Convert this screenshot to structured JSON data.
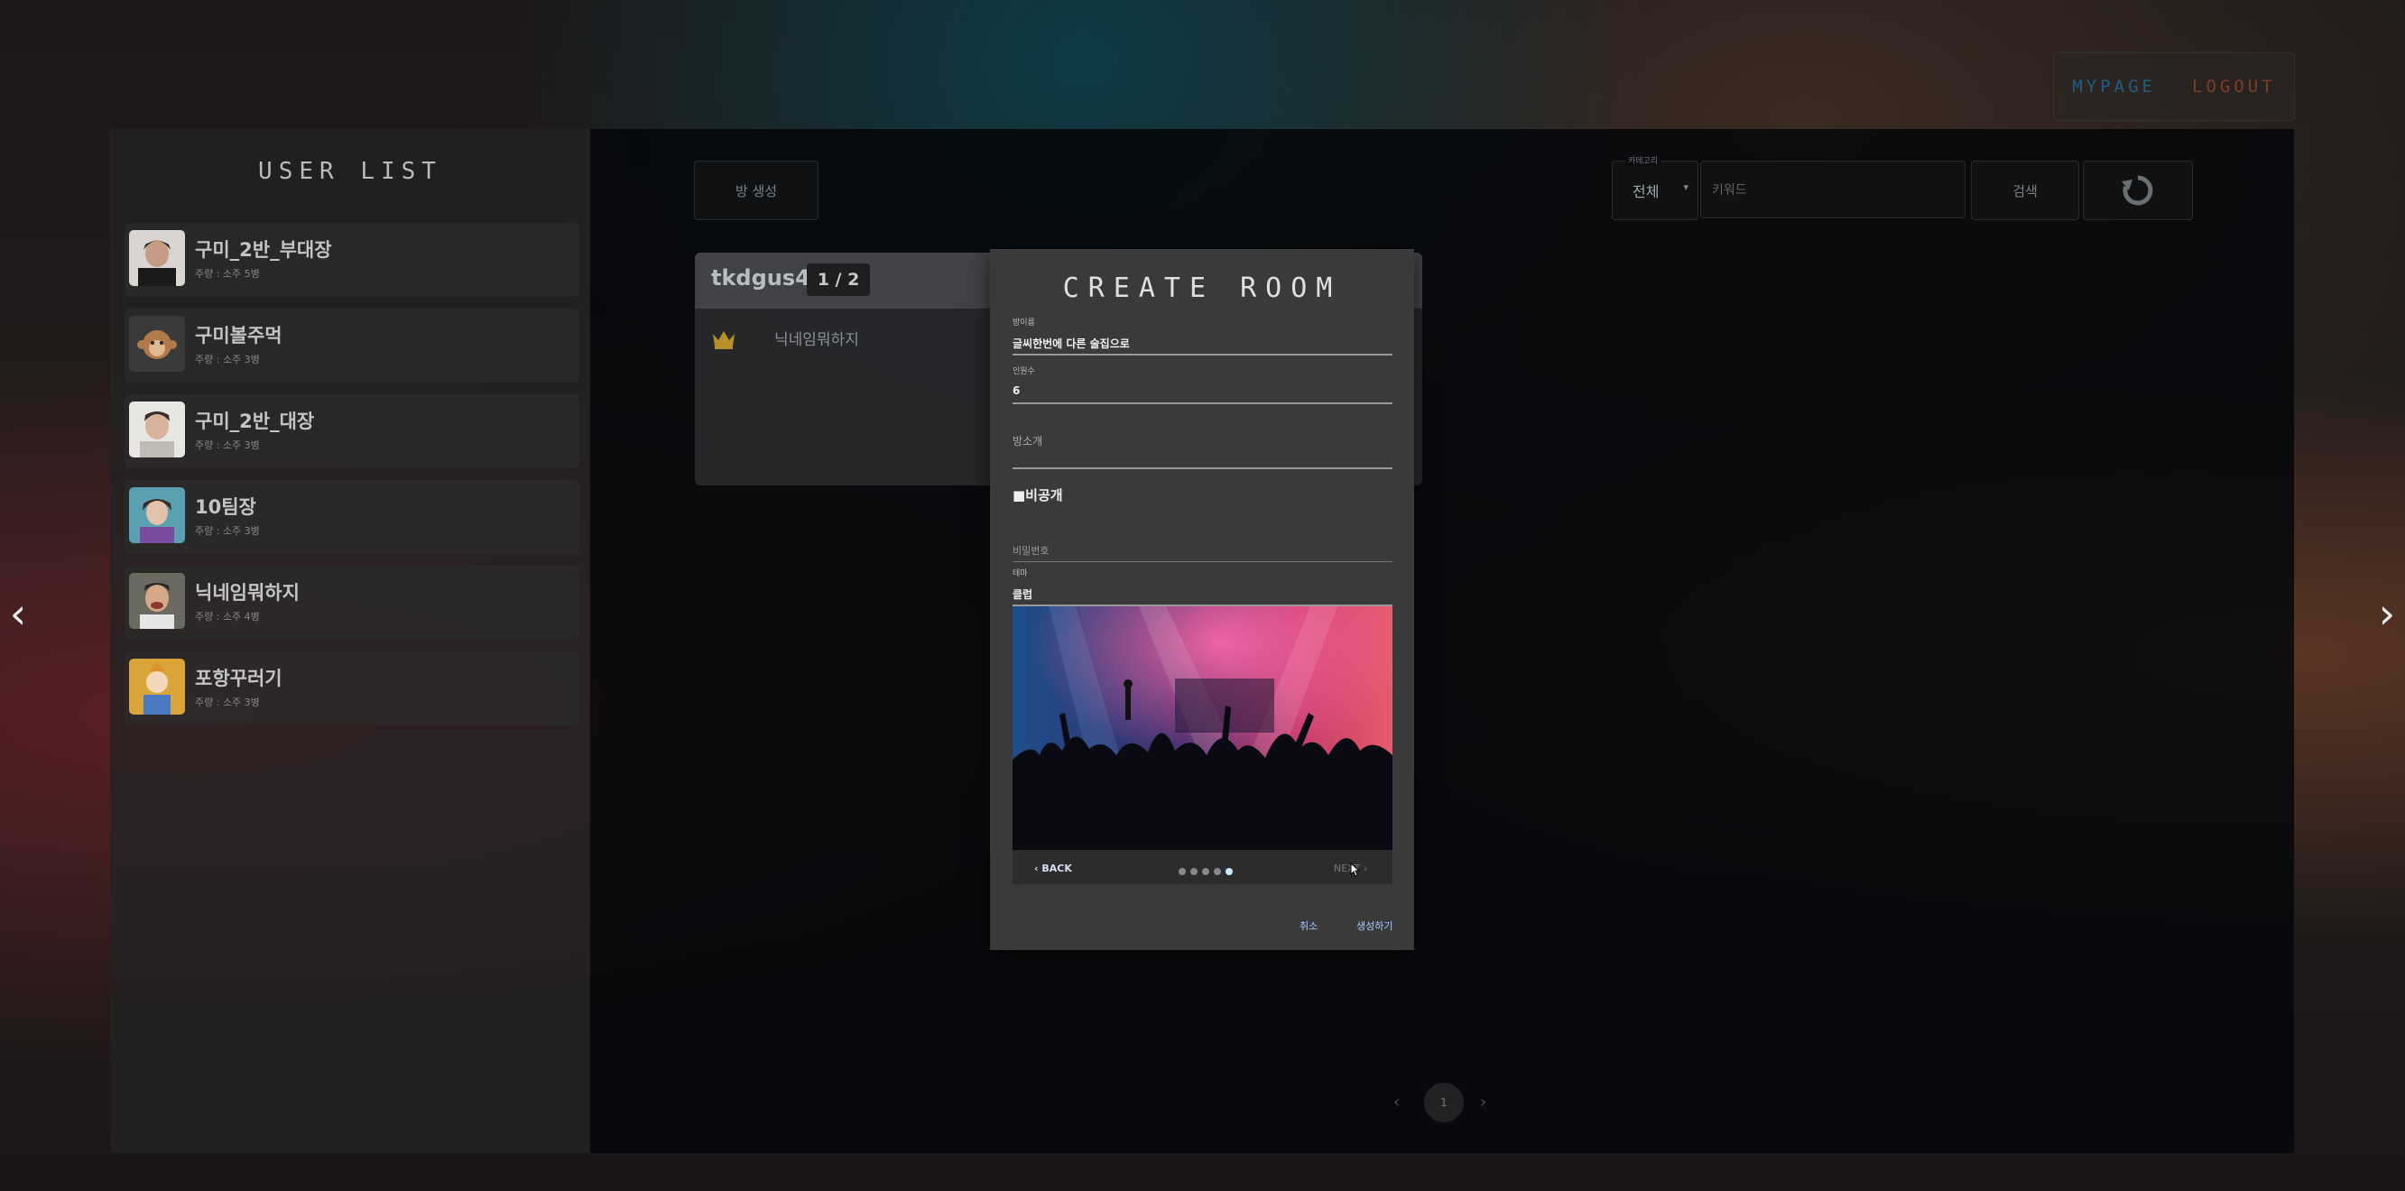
{
  "topnav": {
    "mypage": "MYPAGE",
    "logout": "LOGOUT"
  },
  "user_list": {
    "title": "USER LIST",
    "users": [
      {
        "name": "구미_2반_부대장",
        "sub": "주량 : 소주 5병"
      },
      {
        "name": "구미볼주먹",
        "sub": "주량 : 소주 3병"
      },
      {
        "name": "구미_2반_대장",
        "sub": "주량 : 소주 3병"
      },
      {
        "name": "10팀장",
        "sub": "주량 : 소주 3병"
      },
      {
        "name": "닉네임뭐하지",
        "sub": "주량 : 소주 4병"
      },
      {
        "name": "포항꾸러기",
        "sub": "주량 : 소주 3병"
      }
    ]
  },
  "toolbar": {
    "create_label": "방 생성",
    "category_label": "카테고리",
    "category_value": "전체",
    "keyword_placeholder": "키워드",
    "search_label": "검색"
  },
  "room": {
    "owner": "tkdgus4",
    "count": "1 / 2",
    "member": "닉네임뭐하지"
  },
  "pagination": {
    "current": "1",
    "prev": "‹",
    "next": "›"
  },
  "modal": {
    "title": "CREATE ROOM",
    "room_name_label": "방이름",
    "room_name_value": "글씨한번에 다른 술집으로",
    "capacity_label": "인원수",
    "capacity_value": "6",
    "intro_placeholder": "방소개",
    "private_label": "■비공개",
    "password_placeholder": "비밀번호",
    "theme_label": "테마",
    "theme_value": "클럽",
    "back_label": "BACK",
    "next_label": "NEXT",
    "dots_total": 5,
    "dots_active": 5,
    "cancel_label": "취소",
    "create_label": "생성하기"
  },
  "colors": {
    "mypage": "#1d5f83",
    "logout": "#7a3e2a",
    "modal_bg": "#3a3a3a",
    "action_link": "#a8c7ff"
  },
  "icons": [
    "chevron-left-icon",
    "chevron-right-icon",
    "refresh-icon",
    "crown-icon",
    "chevron-down-icon",
    "cursor-icon"
  ]
}
